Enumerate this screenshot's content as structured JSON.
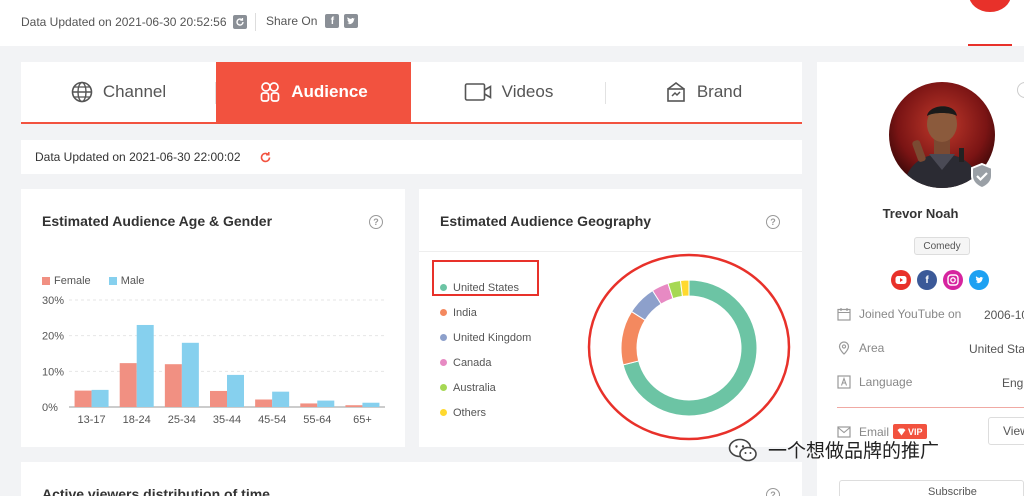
{
  "header": {
    "updated_text": "Data Updated on 2021-06-30 20:52:56",
    "share_label": "Share On",
    "share_icons": [
      "facebook-icon",
      "twitter-icon"
    ]
  },
  "tabs": [
    {
      "label": "Channel",
      "icon": "globe-icon",
      "active": false
    },
    {
      "label": "Audience",
      "icon": "audience-icon",
      "active": true
    },
    {
      "label": "Videos",
      "icon": "video-camera-icon",
      "active": false
    },
    {
      "label": "Brand",
      "icon": "brand-icon",
      "active": false
    }
  ],
  "sub_updated_text": "Data Updated on 2021-06-30 22:00:02",
  "age_gender": {
    "title": "Estimated Audience Age & Gender",
    "help": "?",
    "legend": {
      "female": "Female",
      "male": "Male"
    }
  },
  "geography": {
    "title": "Estimated Audience Geography",
    "help": "?",
    "legend": [
      "United States",
      "India",
      "United Kingdom",
      "Canada",
      "Australia",
      "Others"
    ],
    "colors": [
      "#6cc4a4",
      "#f4895f",
      "#8da0cb",
      "#e78ac3",
      "#a6d854",
      "#ffd92f"
    ]
  },
  "chart_data": [
    {
      "type": "bar",
      "categories": [
        "13-17",
        "18-24",
        "25-34",
        "35-44",
        "45-54",
        "55-64",
        "65+"
      ],
      "series": [
        {
          "name": "Female",
          "color": "#f19082",
          "values": [
            4.6,
            12.3,
            12.0,
            4.5,
            2.1,
            1.0,
            0.5
          ]
        },
        {
          "name": "Male",
          "color": "#86d0ee",
          "values": [
            4.8,
            23.0,
            18.0,
            9.0,
            4.3,
            1.8,
            1.2
          ]
        }
      ],
      "yticks": [
        "30%",
        "20%",
        "10%",
        "0%"
      ],
      "ylim": [
        0,
        30
      ],
      "grid": true,
      "legend_position": "top-left"
    },
    {
      "type": "pie",
      "donut": true,
      "categories": [
        "United States",
        "India",
        "United Kingdom",
        "Canada",
        "Australia",
        "Others"
      ],
      "values": [
        71,
        13,
        7,
        4,
        3,
        2
      ],
      "colors": [
        "#6cc4a4",
        "#f4895f",
        "#8da0cb",
        "#e78ac3",
        "#a6d854",
        "#ffd92f"
      ],
      "legend_position": "left"
    }
  ],
  "next_card": {
    "title": "Active viewers distribution of time",
    "help": "?"
  },
  "profile": {
    "name": "Trevor Noah",
    "category": "Comedy",
    "socials": [
      {
        "icon": "youtube-icon",
        "color": "#e8312a"
      },
      {
        "icon": "facebook-icon",
        "color": "#3b5998"
      },
      {
        "icon": "instagram-icon",
        "color": "#d6249f"
      },
      {
        "icon": "twitter-icon",
        "color": "#1da1f2"
      }
    ],
    "joined_label": "Joined YouTube on",
    "joined_value": "2006-10",
    "area_label": "Area",
    "area_value": "United Sta",
    "language_label": "Language",
    "language_value": "Eng",
    "email_label": "Email",
    "vip_label": "VIP",
    "view_label": "View",
    "subscribe_label": "Subscribe"
  },
  "watermark": {
    "text": "一个想做品牌的推广"
  }
}
